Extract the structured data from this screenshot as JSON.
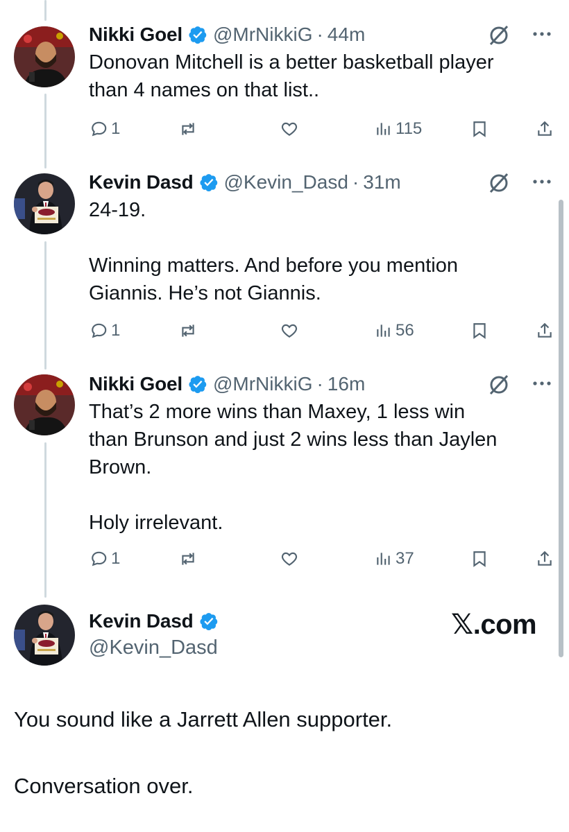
{
  "replies": [
    {
      "name": "Nikki Goel",
      "handle": "@MrNikkiG",
      "dot": "·",
      "time": "44m",
      "text": "Donovan Mitchell is a better basketball player\nthan 4 names on that list..",
      "replies": "1",
      "reposts": "",
      "likes": "",
      "views": "115"
    },
    {
      "name": "Kevin Dasd",
      "handle": "@Kevin_Dasd",
      "dot": "·",
      "time": "31m",
      "text": "24-19.\n\nWinning matters. And before you mention\nGiannis. He’s not Giannis.",
      "replies": "1",
      "reposts": "",
      "likes": "",
      "views": "56"
    },
    {
      "name": "Nikki Goel",
      "handle": "@MrNikkiG",
      "dot": "·",
      "time": "16m",
      "text": "That’s 2 more wins than Maxey, 1 less win\nthan Brunson and just 2 wins less than Jaylen\nBrown.\n\nHoly irrelevant.",
      "replies": "1",
      "reposts": "",
      "likes": "",
      "views": "37"
    }
  ],
  "main_tweet": {
    "name": "Kevin Dasd",
    "handle": "@Kevin_Dasd",
    "text": "You sound like a Jarrett Allen supporter.\n\nConversation over."
  },
  "watermark": "𝕏.com",
  "colors": {
    "verified": "#1d9bf0",
    "secondary_text": "#536471",
    "thread_line": "#cfd9de"
  },
  "icons": [
    "verified-badge-icon",
    "grok-icon",
    "more-icon",
    "reply-icon",
    "repost-icon",
    "like-icon",
    "views-icon",
    "bookmark-icon",
    "share-icon"
  ]
}
